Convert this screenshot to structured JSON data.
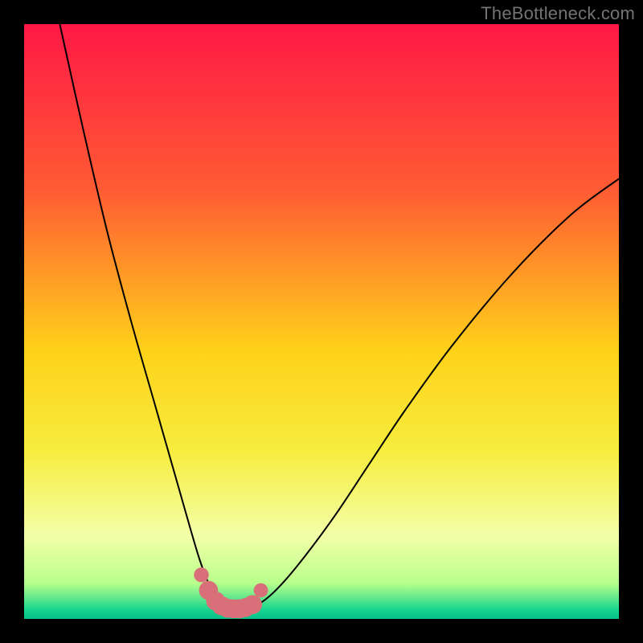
{
  "watermark": "TheBottleneck.com",
  "colors": {
    "frame": "#000000",
    "watermark": "#737373",
    "curve_stroke": "#000000",
    "marker_fill": "#d97079",
    "gradient_stops": [
      {
        "offset": 0.0,
        "color": "#ff1846"
      },
      {
        "offset": 0.28,
        "color": "#ff5c33"
      },
      {
        "offset": 0.55,
        "color": "#ffd21a"
      },
      {
        "offset": 0.72,
        "color": "#f6ed3f"
      },
      {
        "offset": 0.86,
        "color": "#f3ffa8"
      },
      {
        "offset": 0.94,
        "color": "#b8ff8c"
      },
      {
        "offset": 0.965,
        "color": "#60e88c"
      },
      {
        "offset": 0.985,
        "color": "#17d48f"
      },
      {
        "offset": 1.0,
        "color": "#06c18b"
      }
    ]
  },
  "chart_data": {
    "type": "line",
    "title": "",
    "xlabel": "",
    "ylabel": "",
    "xlim": [
      0,
      100
    ],
    "ylim": [
      0,
      100
    ],
    "grid": false,
    "series": [
      {
        "name": "bottleneck-curve",
        "x": [
          6,
          10,
          14,
          18,
          22,
          24,
          26,
          28,
          29.5,
          31,
          32.5,
          34,
          35.5,
          37,
          39,
          42,
          46,
          52,
          58,
          64,
          72,
          82,
          92,
          100
        ],
        "y": [
          100,
          82,
          65,
          50,
          36,
          29,
          22,
          15,
          10,
          6,
          3.2,
          2.0,
          1.6,
          1.6,
          2.2,
          4.5,
          9,
          17,
          26,
          35,
          46,
          58,
          68,
          74
        ]
      }
    ],
    "markers": {
      "name": "flat-region",
      "x": [
        29.8,
        31.0,
        32.2,
        33.2,
        34.2,
        35.2,
        36.2,
        37.2,
        38.4,
        39.8
      ],
      "y": [
        7.4,
        4.8,
        3.0,
        2.2,
        1.8,
        1.7,
        1.7,
        1.9,
        2.4,
        4.8
      ],
      "radius": [
        1.25,
        1.6,
        1.6,
        1.6,
        1.6,
        1.6,
        1.6,
        1.6,
        1.6,
        1.2
      ]
    }
  }
}
